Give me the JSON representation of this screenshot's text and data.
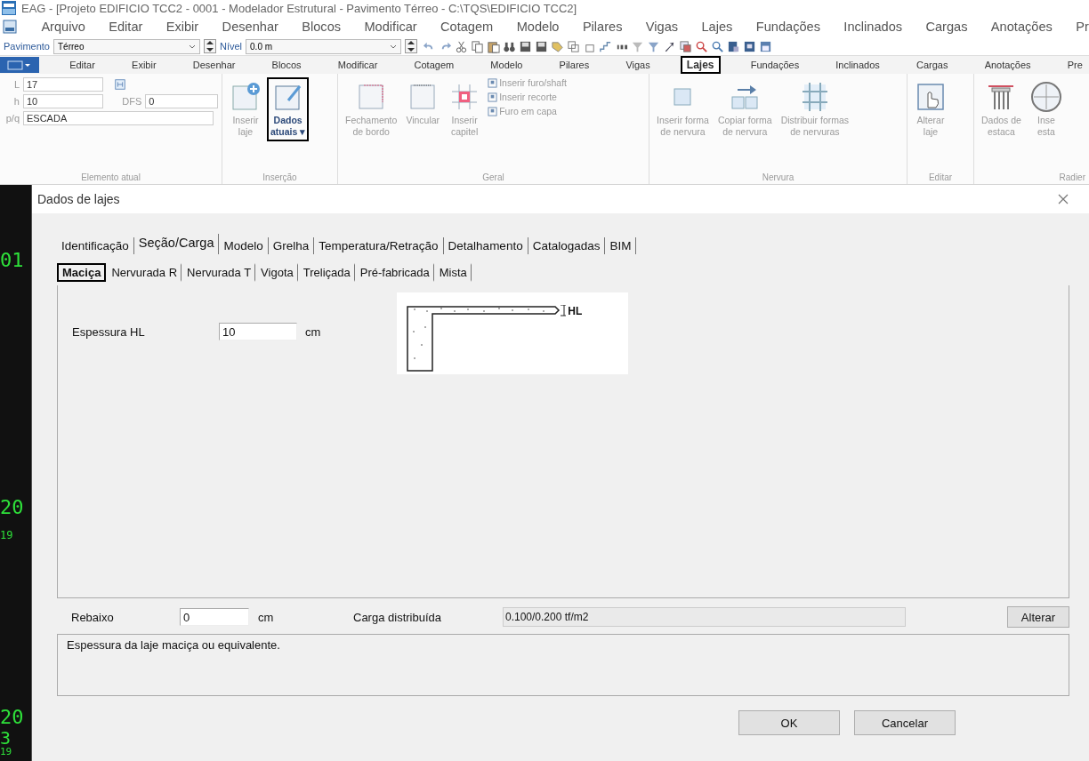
{
  "window": {
    "title": "EAG - [Projeto EDIFICIO TCC2 - 0001 - Modelador Estrutural - Pavimento Térreo - C:\\TQS\\EDIFICIO TCC2]"
  },
  "menu": [
    "Arquivo",
    "Editar",
    "Exibir",
    "Desenhar",
    "Blocos",
    "Modificar",
    "Cotagem",
    "Modelo",
    "Pilares",
    "Vigas",
    "Lajes",
    "Fundações",
    "Inclinados",
    "Cargas",
    "Anotações",
    "Pr"
  ],
  "toolbar": {
    "pavimento_label": "Pavimento",
    "pavimento": "Térreo",
    "nivel_label": "Nível",
    "nivel": "0.0 m"
  },
  "ribbon_tabs": [
    {
      "label": "Editar",
      "selected": false,
      "highlighted": false
    },
    {
      "label": "Exibir",
      "selected": false,
      "highlighted": false
    },
    {
      "label": "Desenhar",
      "selected": false,
      "highlighted": false
    },
    {
      "label": "Blocos",
      "selected": false,
      "highlighted": false
    },
    {
      "label": "Modificar",
      "selected": false,
      "highlighted": false
    },
    {
      "label": "Cotagem",
      "selected": false,
      "highlighted": false
    },
    {
      "label": "Modelo",
      "selected": false,
      "highlighted": false
    },
    {
      "label": "Pilares",
      "selected": false,
      "highlighted": false
    },
    {
      "label": "Vigas",
      "selected": false,
      "highlighted": false
    },
    {
      "label": "Lajes",
      "selected": true,
      "highlighted": true
    },
    {
      "label": "Fundações",
      "selected": false,
      "highlighted": false
    },
    {
      "label": "Inclinados",
      "selected": false,
      "highlighted": false
    },
    {
      "label": "Cargas",
      "selected": false,
      "highlighted": false
    },
    {
      "label": "Anotações",
      "selected": false,
      "highlighted": false
    },
    {
      "label": "Pre",
      "selected": false,
      "highlighted": false
    }
  ],
  "element": {
    "title": "Elemento atual",
    "fields": [
      {
        "label": "L",
        "value": "17"
      },
      {
        "label": "h",
        "value": "10"
      },
      {
        "label": "DFS",
        "value": "0"
      },
      {
        "label": "p/q",
        "value": "ESCADA"
      }
    ]
  },
  "ribbon_groups": [
    {
      "title": "Inserção",
      "buttons": [
        {
          "kind": "add",
          "lines": [
            "Inserir",
            "laje"
          ],
          "disabled": true,
          "highlighted": false
        },
        {
          "kind": "edit",
          "lines": [
            "Dados",
            "atuais ▾"
          ],
          "disabled": false,
          "highlighted": true
        }
      ]
    },
    {
      "title": "Geral",
      "buttons": [
        {
          "kind": "border",
          "lines": [
            "Fechamento",
            "de bordo"
          ],
          "disabled": true,
          "highlighted": false
        },
        {
          "kind": "link",
          "lines": [
            "Vincular"
          ],
          "disabled": true,
          "highlighted": false
        },
        {
          "kind": "capital",
          "lines": [
            "Inserir",
            "capitel"
          ],
          "disabled": true,
          "highlighted": false
        }
      ],
      "small": [
        "Inserir furo/shaft",
        "Inserir recorte",
        "Furo em capa"
      ]
    },
    {
      "title": "Nervura",
      "buttons": [
        {
          "kind": "rib",
          "lines": [
            "Inserir forma",
            "de nervura"
          ],
          "disabled": true,
          "highlighted": false
        },
        {
          "kind": "copy",
          "lines": [
            "Copiar forma",
            "de nervura"
          ],
          "disabled": true,
          "highlighted": false
        },
        {
          "kind": "grid",
          "lines": [
            "Distribuir formas",
            "de nervuras"
          ],
          "disabled": true,
          "highlighted": false
        }
      ]
    },
    {
      "title": "Editar",
      "buttons": [
        {
          "kind": "hand",
          "lines": [
            "Alterar",
            "laje"
          ],
          "disabled": true,
          "highlighted": false
        }
      ]
    },
    {
      "title": "Radier",
      "buttons": [
        {
          "kind": "pile",
          "lines": [
            "Dados de",
            "estaca"
          ],
          "disabled": true,
          "highlighted": false
        },
        {
          "kind": "circle",
          "lines": [
            "Inse",
            "esta"
          ],
          "disabled": true,
          "highlighted": false
        }
      ]
    }
  ],
  "cad_labels": [
    "01",
    "20",
    "19",
    "20",
    "3",
    "19"
  ],
  "dialog": {
    "title": "Dados de lajes",
    "tabs": [
      {
        "label": "Identificação",
        "selected": false
      },
      {
        "label": "Seção/Carga",
        "selected": true
      },
      {
        "label": "Modelo",
        "selected": false
      },
      {
        "label": "Grelha",
        "selected": false
      },
      {
        "label": "Temperatura/Retração",
        "selected": false
      },
      {
        "label": "Detalhamento",
        "selected": false
      },
      {
        "label": "Catalogadas",
        "selected": false
      },
      {
        "label": "BIM",
        "selected": false
      }
    ],
    "subtabs": [
      {
        "label": "Maciça",
        "selected": true,
        "highlighted": true
      },
      {
        "label": "Nervurada R",
        "selected": false,
        "highlighted": false
      },
      {
        "label": "Nervurada T",
        "selected": false,
        "highlighted": false
      },
      {
        "label": "Vigota",
        "selected": false,
        "highlighted": false
      },
      {
        "label": "Treliçada",
        "selected": false,
        "highlighted": false
      },
      {
        "label": "Pré-fabricada",
        "selected": false,
        "highlighted": false
      },
      {
        "label": "Mista",
        "selected": false,
        "highlighted": false
      }
    ],
    "espessura": {
      "label": "Espessura HL",
      "value": "10",
      "unit": "cm"
    },
    "diagram_label": "HL",
    "rebaixo": {
      "label": "Rebaixo",
      "value": "0",
      "unit": "cm"
    },
    "carga": {
      "label": "Carga distribuída",
      "value": "0.100/0.200 tf/m2"
    },
    "alterar": "Alterar",
    "help": "Espessura da laje maciça ou equivalente.",
    "buttons": [
      "OK",
      "Cancelar"
    ]
  }
}
